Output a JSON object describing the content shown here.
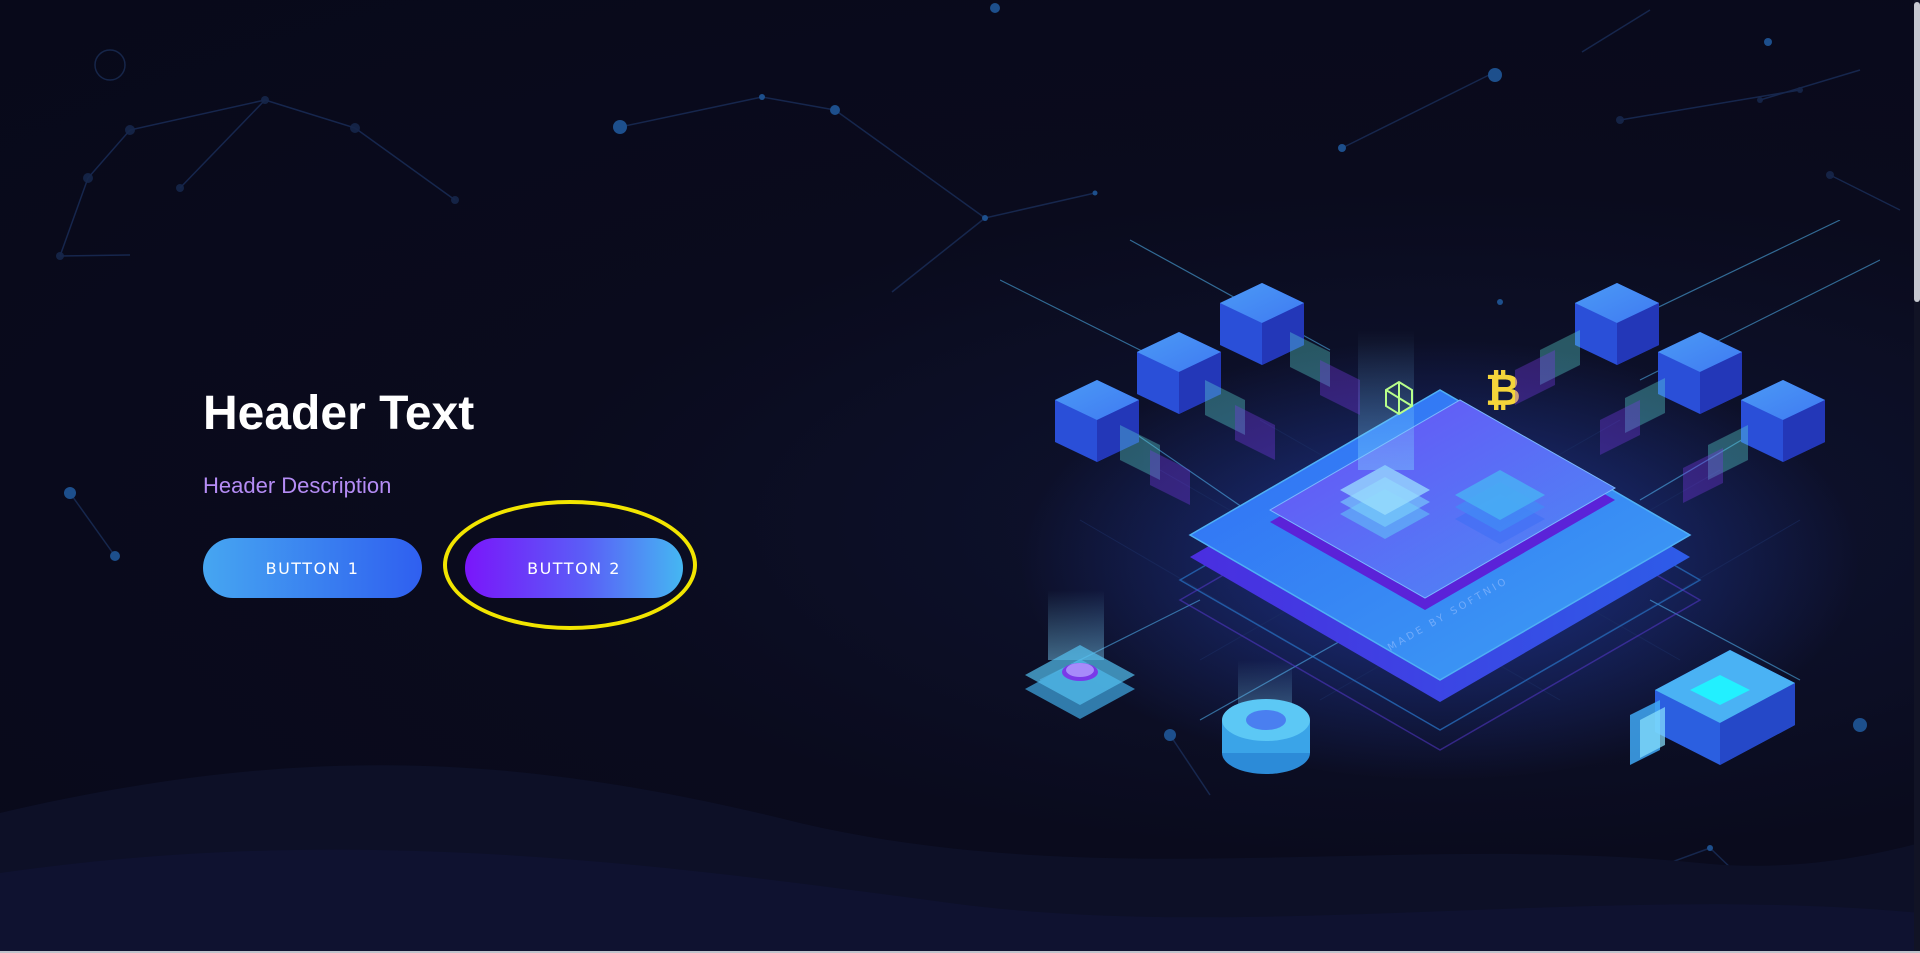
{
  "hero": {
    "title": "Header Text",
    "description": "Header Description",
    "button1_label": "BUTTON 1",
    "button2_label": "BUTTON 2"
  },
  "colors": {
    "background": "#0a0b1c",
    "title": "#ffffff",
    "description": "#b58cf5",
    "button1_gradient": [
      "#46a6f1",
      "#2f5ff0"
    ],
    "button2_gradient": [
      "#7a16fa",
      "#45b7f2"
    ],
    "highlight_ring": "#f2e500",
    "cube_blue": "#2f5ff0",
    "bitcoin": "#f5d53a"
  },
  "illustration": {
    "semantic": "isometric blockchain platform illustration",
    "icons": [
      "bitcoin-icon",
      "network-cube-icon",
      "ethereum-coin-icon"
    ],
    "platform_engraving": "MADE BY SOFTNIO"
  }
}
